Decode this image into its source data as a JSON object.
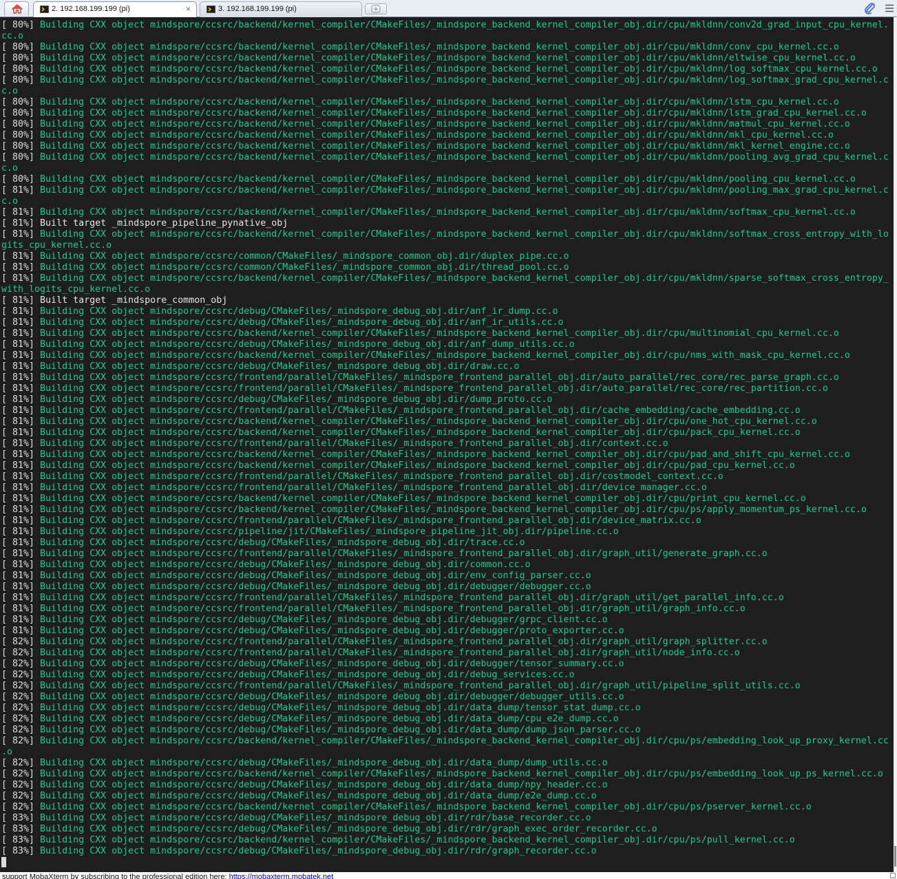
{
  "tabs": [
    {
      "label": "2. 192.168.199.199 (pi)",
      "active": true,
      "close_glyph": "×"
    },
    {
      "label": "3. 192.168.199.199 (pi)",
      "active": false
    }
  ],
  "icons": {
    "home": "home-icon",
    "session": "terminal-session-icon",
    "close": "close-icon",
    "new_tab": "new-tab-icon",
    "attach": "paperclip-icon",
    "menu": "hamburger-menu-icon"
  },
  "colors": {
    "terminal_bg": "#1e1e1e",
    "build_text": "#1ecc8e",
    "default_text": "#e6e6e6"
  },
  "terminal": {
    "lines": [
      {
        "prefix": "[ 80%] ",
        "text": "Building CXX object mindspore/ccsrc/backend/kernel_compiler/CMakeFiles/_mindspore_backend_kernel_compiler_obj.dir/cpu/mkldnn/conv2d_grad_input_cpu_kernel."
      },
      {
        "prefix": "",
        "text": "cc.o"
      },
      {
        "prefix": "[ 80%] ",
        "text": "Building CXX object mindspore/ccsrc/backend/kernel_compiler/CMakeFiles/_mindspore_backend_kernel_compiler_obj.dir/cpu/mkldnn/conv_cpu_kernel.cc.o"
      },
      {
        "prefix": "[ 80%] ",
        "text": "Building CXX object mindspore/ccsrc/backend/kernel_compiler/CMakeFiles/_mindspore_backend_kernel_compiler_obj.dir/cpu/mkldnn/eltwise_cpu_kernel.cc.o"
      },
      {
        "prefix": "[ 80%] ",
        "text": "Building CXX object mindspore/ccsrc/backend/kernel_compiler/CMakeFiles/_mindspore_backend_kernel_compiler_obj.dir/cpu/mkldnn/log_softmax_cpu_kernel.cc.o"
      },
      {
        "prefix": "[ 80%] ",
        "text": "Building CXX object mindspore/ccsrc/backend/kernel_compiler/CMakeFiles/_mindspore_backend_kernel_compiler_obj.dir/cpu/mkldnn/log_softmax_grad_cpu_kernel.c"
      },
      {
        "prefix": "",
        "text": "c.o"
      },
      {
        "prefix": "[ 80%] ",
        "text": "Building CXX object mindspore/ccsrc/backend/kernel_compiler/CMakeFiles/_mindspore_backend_kernel_compiler_obj.dir/cpu/mkldnn/lstm_cpu_kernel.cc.o"
      },
      {
        "prefix": "[ 80%] ",
        "text": "Building CXX object mindspore/ccsrc/backend/kernel_compiler/CMakeFiles/_mindspore_backend_kernel_compiler_obj.dir/cpu/mkldnn/lstm_grad_cpu_kernel.cc.o"
      },
      {
        "prefix": "[ 80%] ",
        "text": "Building CXX object mindspore/ccsrc/backend/kernel_compiler/CMakeFiles/_mindspore_backend_kernel_compiler_obj.dir/cpu/mkldnn/matmul_cpu_kernel.cc.o"
      },
      {
        "prefix": "[ 80%] ",
        "text": "Building CXX object mindspore/ccsrc/backend/kernel_compiler/CMakeFiles/_mindspore_backend_kernel_compiler_obj.dir/cpu/mkldnn/mkl_cpu_kernel.cc.o"
      },
      {
        "prefix": "[ 80%] ",
        "text": "Building CXX object mindspore/ccsrc/backend/kernel_compiler/CMakeFiles/_mindspore_backend_kernel_compiler_obj.dir/cpu/mkldnn/mkl_kernel_engine.cc.o"
      },
      {
        "prefix": "[ 80%] ",
        "text": "Building CXX object mindspore/ccsrc/backend/kernel_compiler/CMakeFiles/_mindspore_backend_kernel_compiler_obj.dir/cpu/mkldnn/pooling_avg_grad_cpu_kernel.c"
      },
      {
        "prefix": "",
        "text": "c.o"
      },
      {
        "prefix": "[ 80%] ",
        "text": "Building CXX object mindspore/ccsrc/backend/kernel_compiler/CMakeFiles/_mindspore_backend_kernel_compiler_obj.dir/cpu/mkldnn/pooling_cpu_kernel.cc.o"
      },
      {
        "prefix": "[ 81%] ",
        "text": "Building CXX object mindspore/ccsrc/backend/kernel_compiler/CMakeFiles/_mindspore_backend_kernel_compiler_obj.dir/cpu/mkldnn/pooling_max_grad_cpu_kernel.c"
      },
      {
        "prefix": "",
        "text": "c.o"
      },
      {
        "prefix": "[ 81%] ",
        "text": "Building CXX object mindspore/ccsrc/backend/kernel_compiler/CMakeFiles/_mindspore_backend_kernel_compiler_obj.dir/cpu/mkldnn/softmax_cpu_kernel.cc.o"
      },
      {
        "prefix": "[ 81%] ",
        "text": "Built target _mindspore_pipeline_pynative_obj",
        "style": "built"
      },
      {
        "prefix": "[ 81%] ",
        "text": "Building CXX object mindspore/ccsrc/backend/kernel_compiler/CMakeFiles/_mindspore_backend_kernel_compiler_obj.dir/cpu/mkldnn/softmax_cross_entropy_with_lo"
      },
      {
        "prefix": "",
        "text": "gits_cpu_kernel.cc.o"
      },
      {
        "prefix": "[ 81%] ",
        "text": "Building CXX object mindspore/ccsrc/common/CMakeFiles/_mindspore_common_obj.dir/duplex_pipe.cc.o"
      },
      {
        "prefix": "[ 81%] ",
        "text": "Building CXX object mindspore/ccsrc/common/CMakeFiles/_mindspore_common_obj.dir/thread_pool.cc.o"
      },
      {
        "prefix": "[ 81%] ",
        "text": "Building CXX object mindspore/ccsrc/backend/kernel_compiler/CMakeFiles/_mindspore_backend_kernel_compiler_obj.dir/cpu/mkldnn/sparse_softmax_cross_entropy_"
      },
      {
        "prefix": "",
        "text": "with_logits_cpu_kernel.cc.o"
      },
      {
        "prefix": "[ 81%] ",
        "text": "Built target _mindspore_common_obj",
        "style": "built"
      },
      {
        "prefix": "[ 81%] ",
        "text": "Building CXX object mindspore/ccsrc/debug/CMakeFiles/_mindspore_debug_obj.dir/anf_ir_dump.cc.o"
      },
      {
        "prefix": "[ 81%] ",
        "text": "Building CXX object mindspore/ccsrc/debug/CMakeFiles/_mindspore_debug_obj.dir/anf_ir_utils.cc.o"
      },
      {
        "prefix": "[ 81%] ",
        "text": "Building CXX object mindspore/ccsrc/backend/kernel_compiler/CMakeFiles/_mindspore_backend_kernel_compiler_obj.dir/cpu/multinomial_cpu_kernel.cc.o"
      },
      {
        "prefix": "[ 81%] ",
        "text": "Building CXX object mindspore/ccsrc/debug/CMakeFiles/_mindspore_debug_obj.dir/anf_dump_utils.cc.o"
      },
      {
        "prefix": "[ 81%] ",
        "text": "Building CXX object mindspore/ccsrc/backend/kernel_compiler/CMakeFiles/_mindspore_backend_kernel_compiler_obj.dir/cpu/nms_with_mask_cpu_kernel.cc.o"
      },
      {
        "prefix": "[ 81%] ",
        "text": "Building CXX object mindspore/ccsrc/debug/CMakeFiles/_mindspore_debug_obj.dir/draw.cc.o"
      },
      {
        "prefix": "[ 81%] ",
        "text": "Building CXX object mindspore/ccsrc/frontend/parallel/CMakeFiles/_mindspore_frontend_parallel_obj.dir/auto_parallel/rec_core/rec_parse_graph.cc.o"
      },
      {
        "prefix": "[ 81%] ",
        "text": "Building CXX object mindspore/ccsrc/frontend/parallel/CMakeFiles/_mindspore_frontend_parallel_obj.dir/auto_parallel/rec_core/rec_partition.cc.o"
      },
      {
        "prefix": "[ 81%] ",
        "text": "Building CXX object mindspore/ccsrc/debug/CMakeFiles/_mindspore_debug_obj.dir/dump_proto.cc.o"
      },
      {
        "prefix": "[ 81%] ",
        "text": "Building CXX object mindspore/ccsrc/frontend/parallel/CMakeFiles/_mindspore_frontend_parallel_obj.dir/cache_embedding/cache_embedding.cc.o"
      },
      {
        "prefix": "[ 81%] ",
        "text": "Building CXX object mindspore/ccsrc/backend/kernel_compiler/CMakeFiles/_mindspore_backend_kernel_compiler_obj.dir/cpu/one_hot_cpu_kernel.cc.o"
      },
      {
        "prefix": "[ 81%] ",
        "text": "Building CXX object mindspore/ccsrc/backend/kernel_compiler/CMakeFiles/_mindspore_backend_kernel_compiler_obj.dir/cpu/pack_cpu_kernel.cc.o"
      },
      {
        "prefix": "[ 81%] ",
        "text": "Building CXX object mindspore/ccsrc/frontend/parallel/CMakeFiles/_mindspore_frontend_parallel_obj.dir/context.cc.o"
      },
      {
        "prefix": "[ 81%] ",
        "text": "Building CXX object mindspore/ccsrc/backend/kernel_compiler/CMakeFiles/_mindspore_backend_kernel_compiler_obj.dir/cpu/pad_and_shift_cpu_kernel.cc.o"
      },
      {
        "prefix": "[ 81%] ",
        "text": "Building CXX object mindspore/ccsrc/backend/kernel_compiler/CMakeFiles/_mindspore_backend_kernel_compiler_obj.dir/cpu/pad_cpu_kernel.cc.o"
      },
      {
        "prefix": "[ 81%] ",
        "text": "Building CXX object mindspore/ccsrc/frontend/parallel/CMakeFiles/_mindspore_frontend_parallel_obj.dir/costmodel_context.cc.o"
      },
      {
        "prefix": "[ 81%] ",
        "text": "Building CXX object mindspore/ccsrc/frontend/parallel/CMakeFiles/_mindspore_frontend_parallel_obj.dir/device_manager.cc.o"
      },
      {
        "prefix": "[ 81%] ",
        "text": "Building CXX object mindspore/ccsrc/backend/kernel_compiler/CMakeFiles/_mindspore_backend_kernel_compiler_obj.dir/cpu/print_cpu_kernel.cc.o"
      },
      {
        "prefix": "[ 81%] ",
        "text": "Building CXX object mindspore/ccsrc/backend/kernel_compiler/CMakeFiles/_mindspore_backend_kernel_compiler_obj.dir/cpu/ps/apply_momentum_ps_kernel.cc.o"
      },
      {
        "prefix": "[ 81%] ",
        "text": "Building CXX object mindspore/ccsrc/frontend/parallel/CMakeFiles/_mindspore_frontend_parallel_obj.dir/device_matrix.cc.o"
      },
      {
        "prefix": "[ 81%] ",
        "text": "Building CXX object mindspore/ccsrc/pipeline/jit/CMakeFiles/_mindspore_pipeline_jit_obj.dir/pipeline.cc.o"
      },
      {
        "prefix": "[ 81%] ",
        "text": "Building CXX object mindspore/ccsrc/debug/CMakeFiles/_mindspore_debug_obj.dir/trace.cc.o"
      },
      {
        "prefix": "[ 81%] ",
        "text": "Building CXX object mindspore/ccsrc/frontend/parallel/CMakeFiles/_mindspore_frontend_parallel_obj.dir/graph_util/generate_graph.cc.o"
      },
      {
        "prefix": "[ 81%] ",
        "text": "Building CXX object mindspore/ccsrc/debug/CMakeFiles/_mindspore_debug_obj.dir/common.cc.o"
      },
      {
        "prefix": "[ 81%] ",
        "text": "Building CXX object mindspore/ccsrc/debug/CMakeFiles/_mindspore_debug_obj.dir/env_config_parser.cc.o"
      },
      {
        "prefix": "[ 81%] ",
        "text": "Building CXX object mindspore/ccsrc/debug/CMakeFiles/_mindspore_debug_obj.dir/debugger/debugger.cc.o"
      },
      {
        "prefix": "[ 81%] ",
        "text": "Building CXX object mindspore/ccsrc/frontend/parallel/CMakeFiles/_mindspore_frontend_parallel_obj.dir/graph_util/get_parallel_info.cc.o"
      },
      {
        "prefix": "[ 81%] ",
        "text": "Building CXX object mindspore/ccsrc/frontend/parallel/CMakeFiles/_mindspore_frontend_parallel_obj.dir/graph_util/graph_info.cc.o"
      },
      {
        "prefix": "[ 81%] ",
        "text": "Building CXX object mindspore/ccsrc/debug/CMakeFiles/_mindspore_debug_obj.dir/debugger/grpc_client.cc.o"
      },
      {
        "prefix": "[ 81%] ",
        "text": "Building CXX object mindspore/ccsrc/debug/CMakeFiles/_mindspore_debug_obj.dir/debugger/proto_exporter.cc.o"
      },
      {
        "prefix": "[ 82%] ",
        "text": "Building CXX object mindspore/ccsrc/frontend/parallel/CMakeFiles/_mindspore_frontend_parallel_obj.dir/graph_util/graph_splitter.cc.o"
      },
      {
        "prefix": "[ 82%] ",
        "text": "Building CXX object mindspore/ccsrc/frontend/parallel/CMakeFiles/_mindspore_frontend_parallel_obj.dir/graph_util/node_info.cc.o"
      },
      {
        "prefix": "[ 82%] ",
        "text": "Building CXX object mindspore/ccsrc/debug/CMakeFiles/_mindspore_debug_obj.dir/debugger/tensor_summary.cc.o"
      },
      {
        "prefix": "[ 82%] ",
        "text": "Building CXX object mindspore/ccsrc/debug/CMakeFiles/_mindspore_debug_obj.dir/debug_services.cc.o"
      },
      {
        "prefix": "[ 82%] ",
        "text": "Building CXX object mindspore/ccsrc/frontend/parallel/CMakeFiles/_mindspore_frontend_parallel_obj.dir/graph_util/pipeline_split_utils.cc.o"
      },
      {
        "prefix": "[ 82%] ",
        "text": "Building CXX object mindspore/ccsrc/debug/CMakeFiles/_mindspore_debug_obj.dir/debugger/debugger_utils.cc.o"
      },
      {
        "prefix": "[ 82%] ",
        "text": "Building CXX object mindspore/ccsrc/debug/CMakeFiles/_mindspore_debug_obj.dir/data_dump/tensor_stat_dump.cc.o"
      },
      {
        "prefix": "[ 82%] ",
        "text": "Building CXX object mindspore/ccsrc/debug/CMakeFiles/_mindspore_debug_obj.dir/data_dump/cpu_e2e_dump.cc.o"
      },
      {
        "prefix": "[ 82%] ",
        "text": "Building CXX object mindspore/ccsrc/debug/CMakeFiles/_mindspore_debug_obj.dir/data_dump/dump_json_parser.cc.o"
      },
      {
        "prefix": "[ 82%] ",
        "text": "Building CXX object mindspore/ccsrc/backend/kernel_compiler/CMakeFiles/_mindspore_backend_kernel_compiler_obj.dir/cpu/ps/embedding_look_up_proxy_kernel.cc"
      },
      {
        "prefix": "",
        "text": ".o"
      },
      {
        "prefix": "[ 82%] ",
        "text": "Building CXX object mindspore/ccsrc/debug/CMakeFiles/_mindspore_debug_obj.dir/data_dump/dump_utils.cc.o"
      },
      {
        "prefix": "[ 82%] ",
        "text": "Building CXX object mindspore/ccsrc/backend/kernel_compiler/CMakeFiles/_mindspore_backend_kernel_compiler_obj.dir/cpu/ps/embedding_look_up_ps_kernel.cc.o"
      },
      {
        "prefix": "[ 82%] ",
        "text": "Building CXX object mindspore/ccsrc/debug/CMakeFiles/_mindspore_debug_obj.dir/data_dump/npy_header.cc.o"
      },
      {
        "prefix": "[ 82%] ",
        "text": "Building CXX object mindspore/ccsrc/debug/CMakeFiles/_mindspore_debug_obj.dir/data_dump/e2e_dump.cc.o"
      },
      {
        "prefix": "[ 82%] ",
        "text": "Building CXX object mindspore/ccsrc/backend/kernel_compiler/CMakeFiles/_mindspore_backend_kernel_compiler_obj.dir/cpu/ps/pserver_kernel.cc.o"
      },
      {
        "prefix": "[ 83%] ",
        "text": "Building CXX object mindspore/ccsrc/debug/CMakeFiles/_mindspore_debug_obj.dir/rdr/base_recorder.cc.o"
      },
      {
        "prefix": "[ 83%] ",
        "text": "Building CXX object mindspore/ccsrc/debug/CMakeFiles/_mindspore_debug_obj.dir/rdr/graph_exec_order_recorder.cc.o"
      },
      {
        "prefix": "[ 83%] ",
        "text": "Building CXX object mindspore/ccsrc/backend/kernel_compiler/CMakeFiles/_mindspore_backend_kernel_compiler_obj.dir/cpu/ps/pull_kernel.cc.o"
      },
      {
        "prefix": "[ 83%] ",
        "text": "Building CXX object mindspore/ccsrc/debug/CMakeFiles/_mindspore_debug_obj.dir/rdr/graph_recorder.cc.o"
      }
    ]
  },
  "statusbar": {
    "message": "support MobaXterm by subscribing to the professional edition here:",
    "link": "https://mobaxterm.mobatek.net"
  }
}
